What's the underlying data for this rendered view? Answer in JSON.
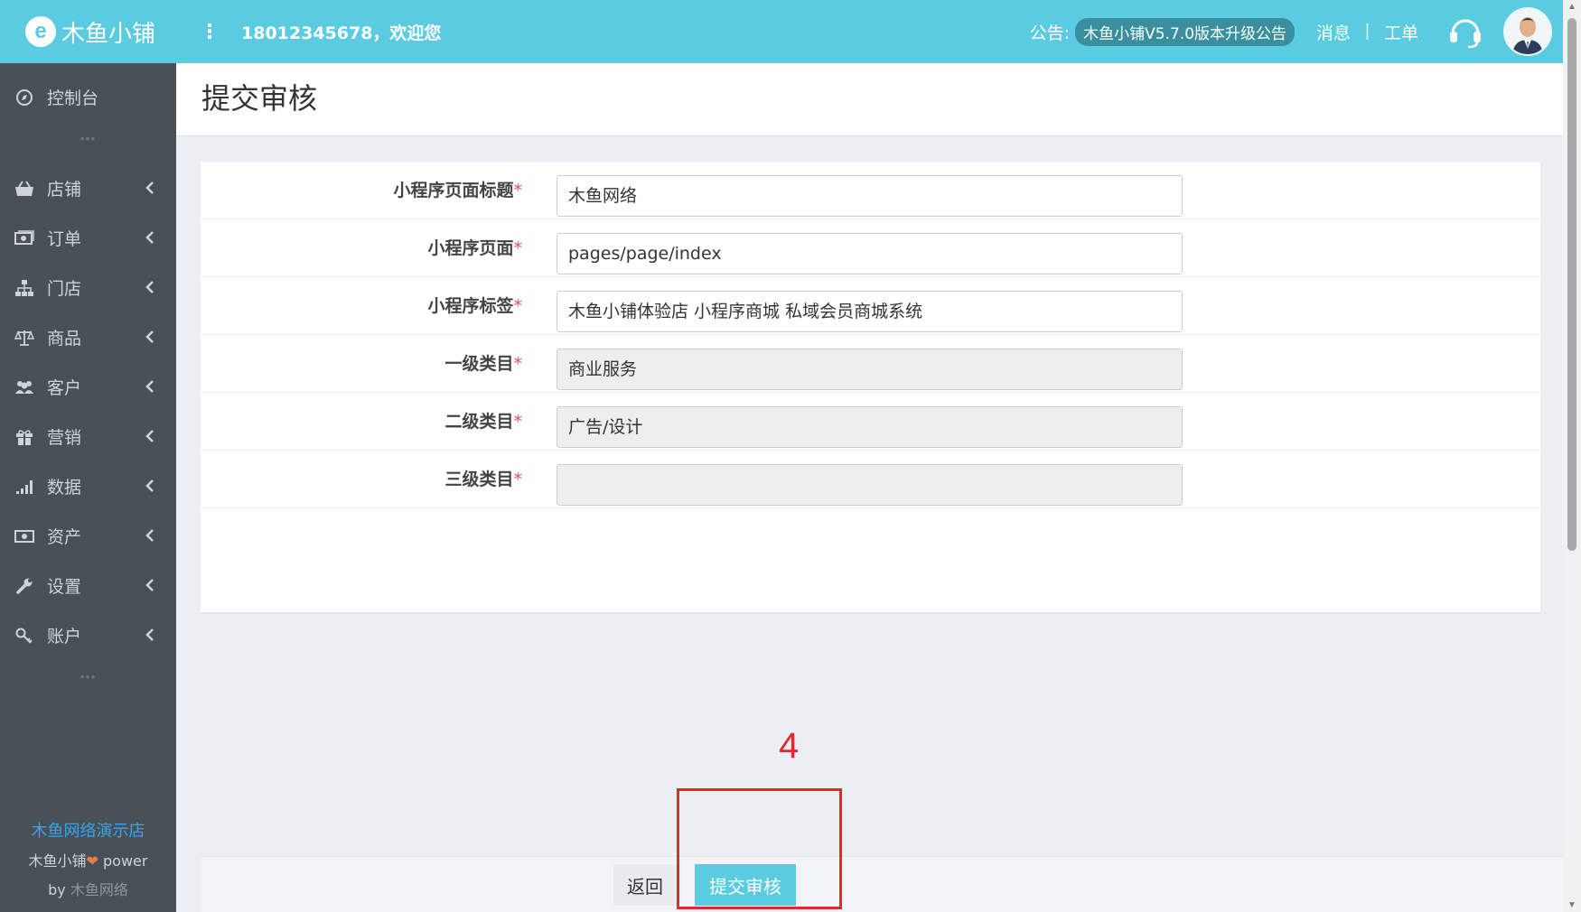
{
  "header": {
    "logo_letter": "e",
    "logo_text": "木鱼小铺",
    "menu_dots": "⋮",
    "welcome": "18012345678，欢迎您",
    "notice_label": "公告:",
    "notice_text": "木鱼小铺V5.7.0版本升级公告",
    "messages": "消息",
    "separator": "|",
    "tickets": "工单"
  },
  "sidebar": {
    "dashboard": "控制台",
    "items": [
      {
        "label": "店铺",
        "icon": "basket-icon"
      },
      {
        "label": "订单",
        "icon": "cash-icon"
      },
      {
        "label": "门店",
        "icon": "sitemap-icon"
      },
      {
        "label": "商品",
        "icon": "scale-icon"
      },
      {
        "label": "客户",
        "icon": "users-icon"
      },
      {
        "label": "营销",
        "icon": "gift-icon"
      },
      {
        "label": "数据",
        "icon": "signal-icon"
      },
      {
        "label": "资产",
        "icon": "money-icon"
      },
      {
        "label": "设置",
        "icon": "wrench-icon"
      },
      {
        "label": "账户",
        "icon": "key-icon"
      }
    ],
    "dash": "•••",
    "footer": {
      "shop_name": "木鱼网络演示店",
      "power_prefix": "木鱼小铺",
      "heart": "❤",
      "power_suffix": " power",
      "by": "by ",
      "by_name": "木鱼网络"
    }
  },
  "page": {
    "title": "提交审核"
  },
  "form": {
    "required_mark": "*",
    "fields": [
      {
        "label": "小程序页面标题",
        "value": "木鱼网络",
        "disabled": false
      },
      {
        "label": "小程序页面",
        "value": "pages/page/index",
        "disabled": false
      },
      {
        "label": "小程序标签",
        "value": "木鱼小铺体验店 小程序商城 私域会员商城系统",
        "disabled": false
      },
      {
        "label": "一级类目",
        "value": "商业服务",
        "disabled": true
      },
      {
        "label": "二级类目",
        "value": "广告/设计",
        "disabled": true
      },
      {
        "label": "三级类目",
        "value": "",
        "disabled": true
      }
    ]
  },
  "footer": {
    "back": "返回",
    "submit": "提交审核"
  },
  "annotation": {
    "number": "4"
  },
  "colors": {
    "primary": "#5acbe0",
    "sidebar": "#485058",
    "annotation": "#e22a2a"
  }
}
